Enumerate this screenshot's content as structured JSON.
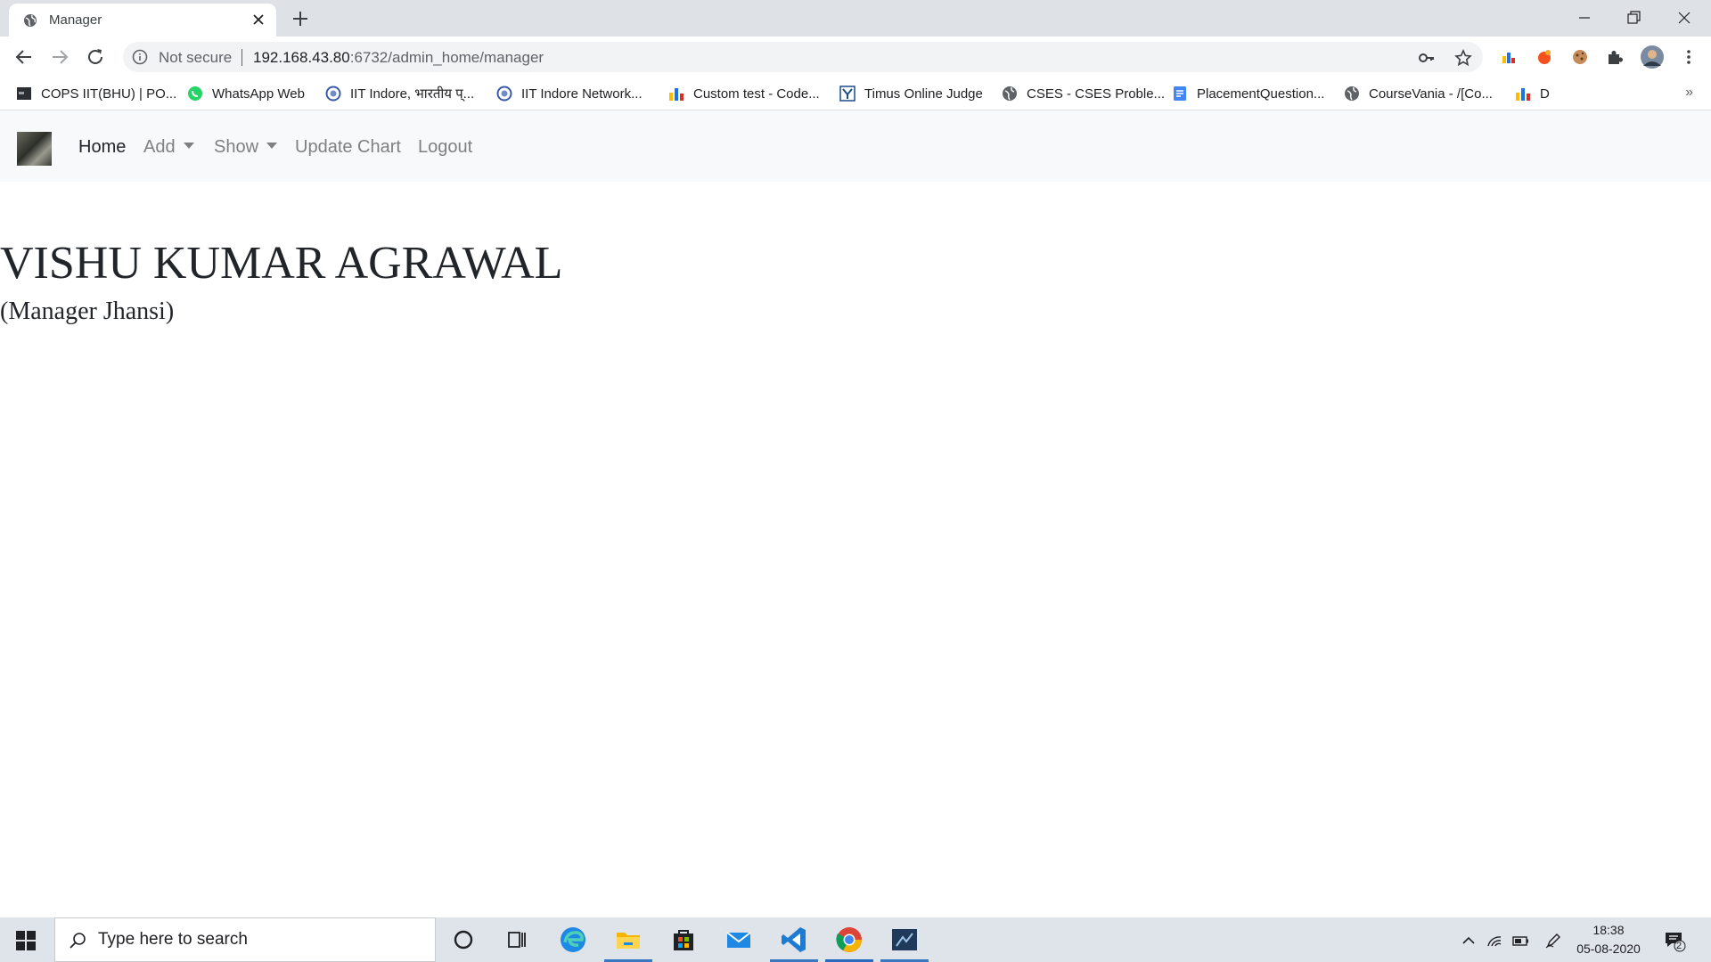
{
  "browser": {
    "tab": {
      "title": "Manager"
    },
    "address": {
      "security_label": "Not secure",
      "url_host": "192.168.43.80",
      "url_rest": ":6732/admin_home/manager"
    },
    "bookmarks": [
      {
        "label": "COPS IIT(BHU) | PO...",
        "icon": "cops-icon"
      },
      {
        "label": "WhatsApp Web",
        "icon": "whatsapp-icon"
      },
      {
        "label": "IIT Indore, भारतीय प्...",
        "icon": "iit-indore-icon"
      },
      {
        "label": "IIT Indore Network...",
        "icon": "iit-indore-network-icon"
      },
      {
        "label": "Custom test - Code...",
        "icon": "codeforces-icon"
      },
      {
        "label": "Timus Online Judge",
        "icon": "timus-icon"
      },
      {
        "label": "CSES - CSES Proble...",
        "icon": "globe-icon"
      },
      {
        "label": "PlacementQuestion...",
        "icon": "docs-icon"
      },
      {
        "label": "CourseVania - /[Co...",
        "icon": "globe-icon"
      },
      {
        "label": "D",
        "icon": "codeforces-icon"
      }
    ],
    "bookmarks_overflow": "»"
  },
  "navbar": {
    "items": [
      {
        "label": "Home",
        "active": true
      },
      {
        "label": "Add",
        "dropdown": true
      },
      {
        "label": "Show",
        "dropdown": true
      },
      {
        "label": "Update Chart"
      },
      {
        "label": "Logout"
      }
    ]
  },
  "profile": {
    "name": "VISHU KUMAR AGRAWAL",
    "role": "(Manager Jhansi)"
  },
  "taskbar": {
    "search_placeholder": "Type here to search",
    "time": "18:38",
    "date": "05-08-2020",
    "notification_count": "2"
  },
  "colors": {
    "tabstrip": "#dee1e6",
    "navbar_bg": "#f8f9fa",
    "nav_link": "#808080",
    "nav_active": "#212529",
    "taskbar": "#dfe3ea",
    "taskbar_active_underline": "#3b78c2"
  }
}
